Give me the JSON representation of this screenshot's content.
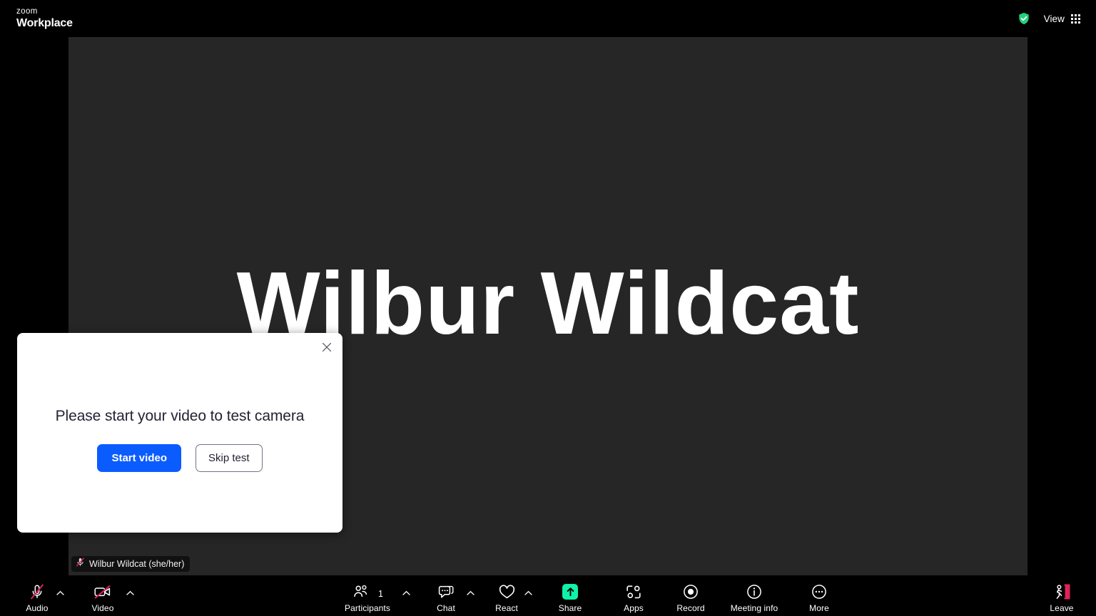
{
  "app": {
    "brand_line1": "zoom",
    "brand_line2": "Workplace"
  },
  "topbar": {
    "encryption_icon": "shield-check-icon",
    "view_label": "View",
    "grid_icon": "grid-view-icon"
  },
  "stage": {
    "display_name": "Wilbur Wildcat",
    "name_tag": "Wilbur Wildcat (she/her)",
    "name_tag_icon": "muted-microphone-icon",
    "tile_background": "#262626",
    "stage_background": "#000000"
  },
  "dialog": {
    "title": "Please start your video to test camera",
    "primary_label": "Start video",
    "secondary_label": "Skip test",
    "close_icon": "close-icon",
    "primary_color": "#0b5cff"
  },
  "toolbar": {
    "background": "#000000",
    "items": [
      {
        "label": "Audio",
        "icon": "microphone-muted-icon",
        "caret": true,
        "badge": ""
      },
      {
        "label": "Video",
        "icon": "camera-muted-icon",
        "caret": true,
        "badge": ""
      },
      {
        "label": "Participants",
        "icon": "participants-icon",
        "caret": true,
        "badge": "1"
      },
      {
        "label": "Chat",
        "icon": "chat-bubble-icon",
        "caret": true,
        "badge": ""
      },
      {
        "label": "React",
        "icon": "heart-icon",
        "caret": true,
        "badge": ""
      },
      {
        "label": "Share",
        "icon": "share-screen-icon",
        "caret": false,
        "badge": ""
      },
      {
        "label": "Apps",
        "icon": "apps-icon",
        "caret": false,
        "badge": ""
      },
      {
        "label": "Record",
        "icon": "record-icon",
        "caret": false,
        "badge": ""
      },
      {
        "label": "Meeting info",
        "icon": "info-circle-icon",
        "caret": false,
        "badge": ""
      },
      {
        "label": "More",
        "icon": "more-dots-icon",
        "caret": false,
        "badge": ""
      }
    ],
    "leave": {
      "label": "Leave",
      "icon": "leave-meeting-icon",
      "color": "#e02459"
    },
    "share_accent": "#0ff2a8"
  }
}
